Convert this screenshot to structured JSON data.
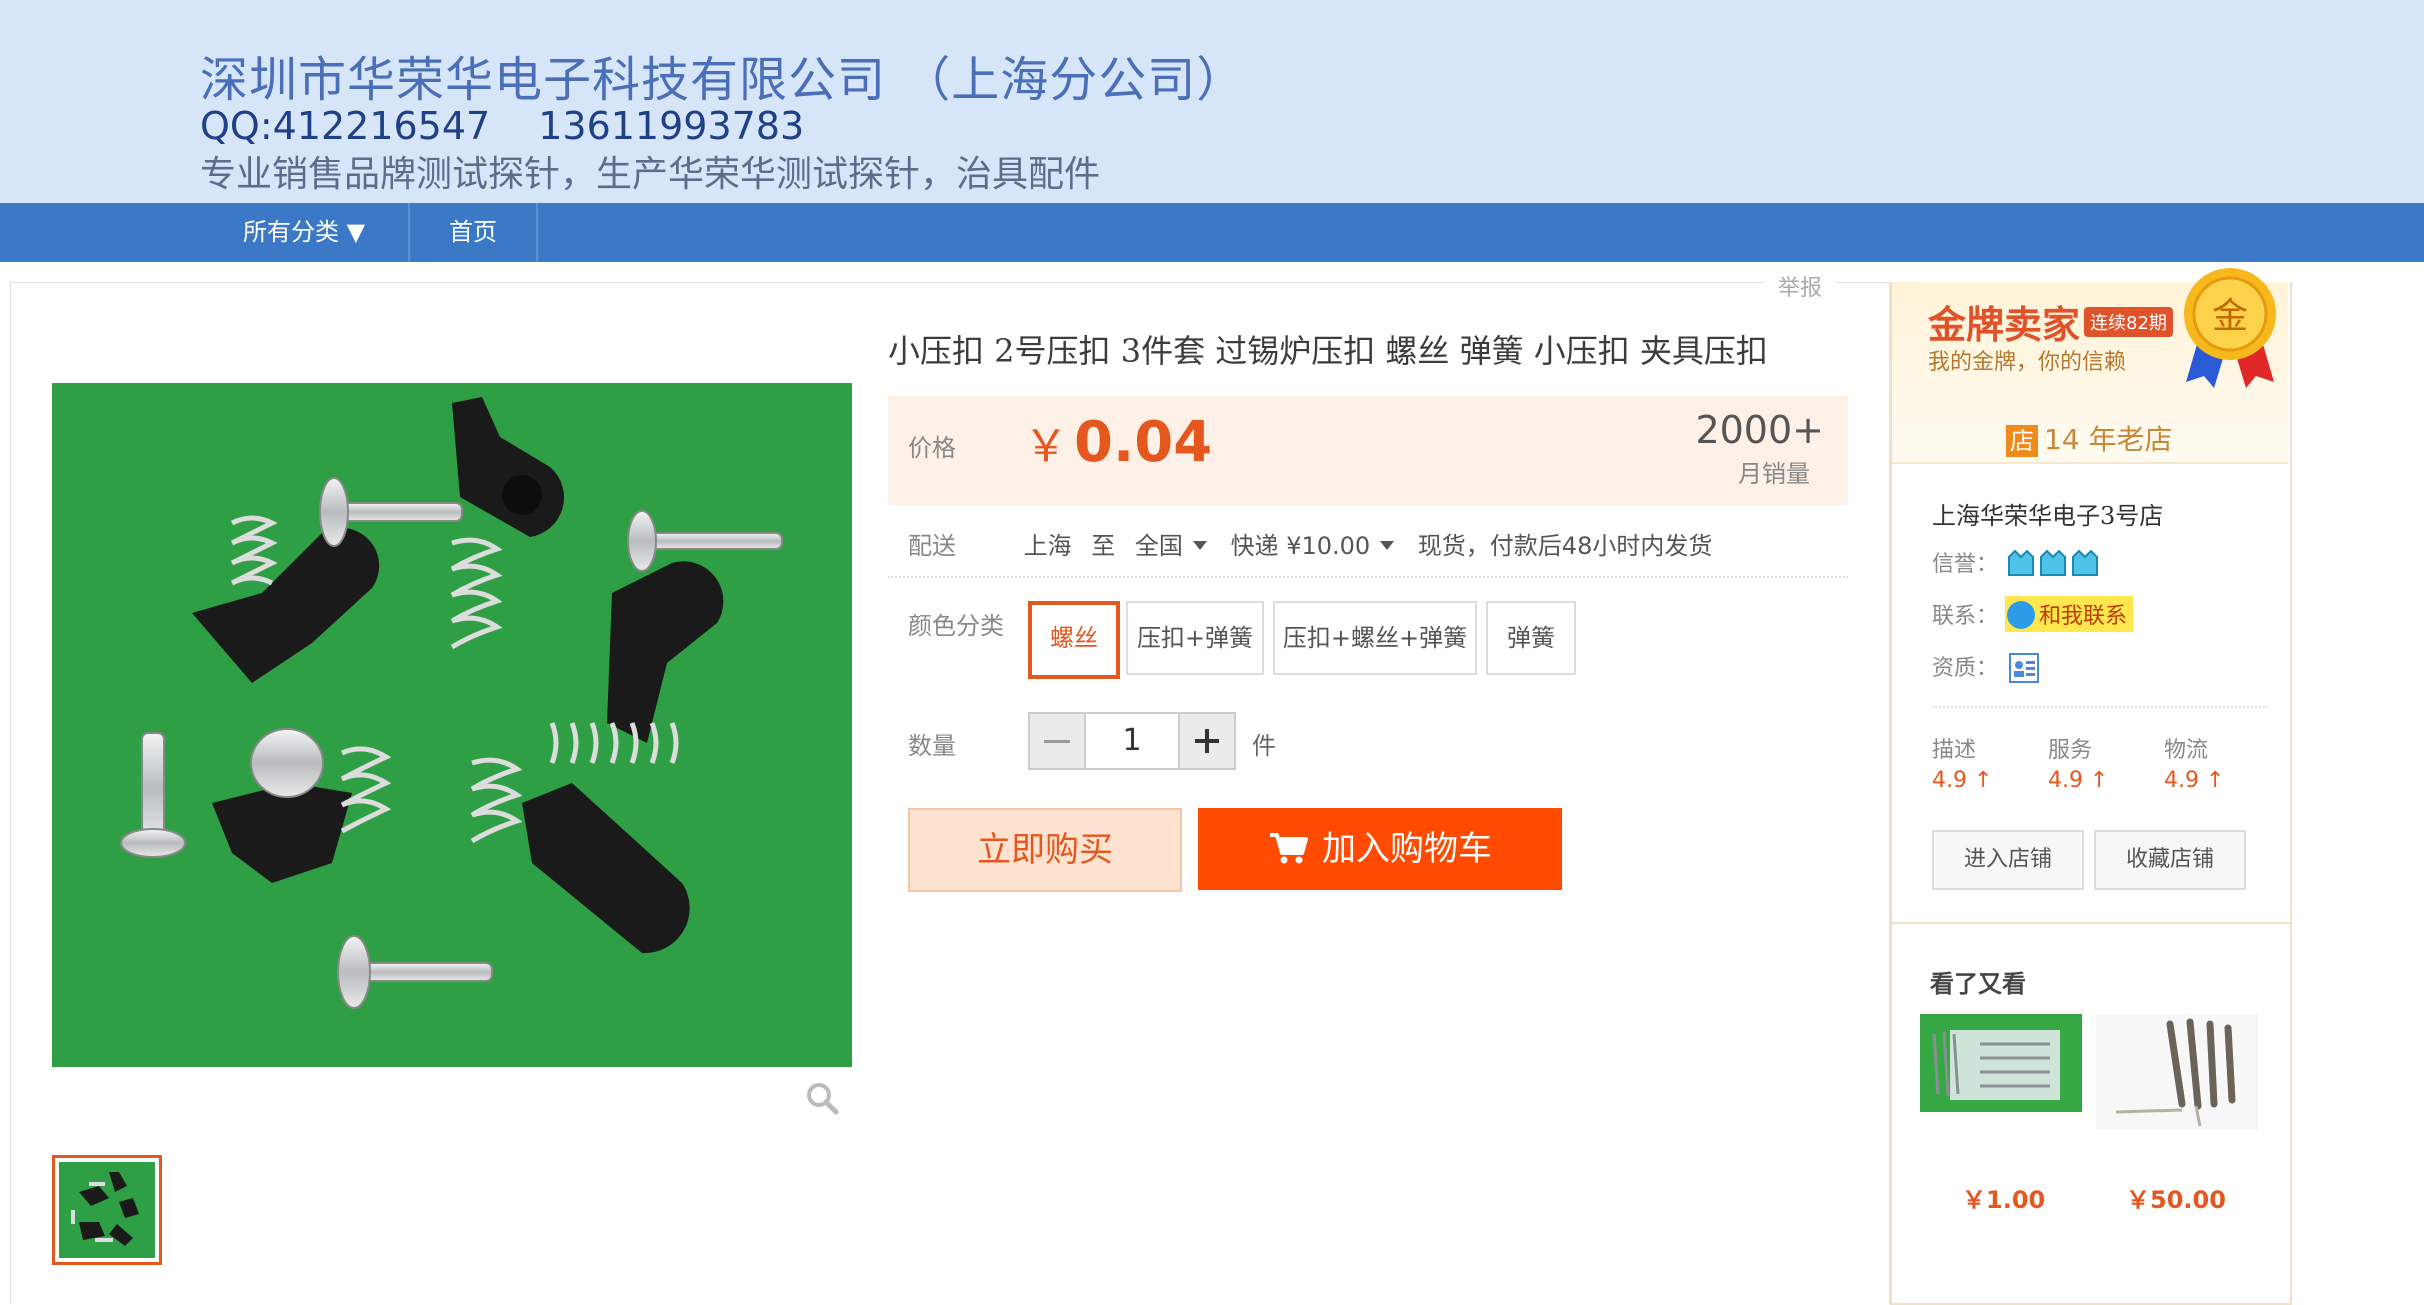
{
  "header": {
    "company": "深圳市华荣华电子科技有限公司 （上海分公司）",
    "qq": "QQ:412216547",
    "phone": "13611993783",
    "slogan": "专业销售品牌测试探针，生产华荣华测试探针，治具配件"
  },
  "nav": {
    "all_categories": "所有分类 ▼",
    "home": "首页"
  },
  "report": "举报",
  "product": {
    "title": "小压扣 2号压扣 3件套 过锡炉压扣 螺丝 弹簧 小压扣 夹具压扣",
    "price_label": "价格",
    "currency": "￥",
    "price": "0.04",
    "monthly_sales": "2000+",
    "monthly_sales_label": "月销量",
    "shipping_label": "配送",
    "ship_from": "上海",
    "ship_to_word": "至",
    "ship_to": "全国",
    "express": "快递 ¥10.00",
    "delivery": "现货，付款后48小时内发货",
    "color_label": "颜色分类",
    "options": [
      "螺丝",
      "压扣+弹簧",
      "压扣+螺丝+弹簧",
      "弹簧"
    ],
    "selected_option": "螺丝",
    "qty_label": "数量",
    "qty": "1",
    "unit": "件",
    "buy_now": "立即购买",
    "add_to_cart": "加入购物车"
  },
  "seller": {
    "gold_title": "金牌卖家",
    "gold_streak": "连续82期",
    "gold_sub": "我的金牌，你的信赖",
    "medal_char": "金",
    "years_icon": "店",
    "years": "14 年老店",
    "shop_name": "上海华荣华电子3号店",
    "credit_label": "信誉：",
    "contact_label": "联系：",
    "contact_btn": "和我联系",
    "qualification_label": "资质：",
    "ratings": [
      {
        "label": "描述",
        "value": "4.9 ↑"
      },
      {
        "label": "服务",
        "value": "4.9 ↑"
      },
      {
        "label": "物流",
        "value": "4.9 ↑"
      }
    ],
    "enter_shop": "进入店铺",
    "fav_shop": "收藏店铺"
  },
  "also_viewed": {
    "title": "看了又看",
    "items": [
      {
        "price": "￥1.00"
      },
      {
        "price": "￥50.00"
      }
    ]
  },
  "colors": {
    "accent": "#e4571f",
    "cart": "#ff4a00",
    "nav": "#3b79c7",
    "header_bg": "#d6e6f8"
  }
}
